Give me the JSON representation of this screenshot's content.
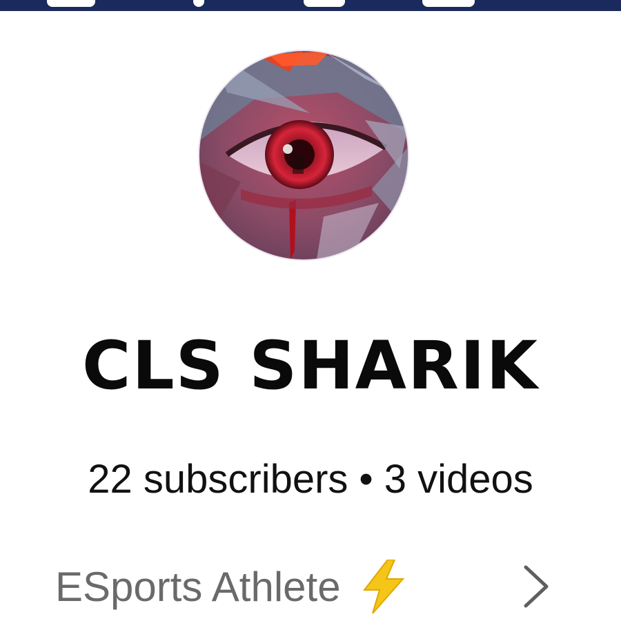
{
  "channel": {
    "name": "CLS SHARIK",
    "subscribers": "22 subscribers",
    "separator": "•",
    "videos": "3 videos",
    "description": "ESports Athlete"
  },
  "icons": {
    "avatar": "red-eye-artwork",
    "description_emoji": "lightning-bolt-icon",
    "expand": "chevron-right-icon"
  },
  "colors": {
    "banner": "#1b2a5c",
    "name": "#0a0a0a",
    "stats": "#111111",
    "description": "#6a6a6a",
    "bolt": "#f5c518"
  }
}
